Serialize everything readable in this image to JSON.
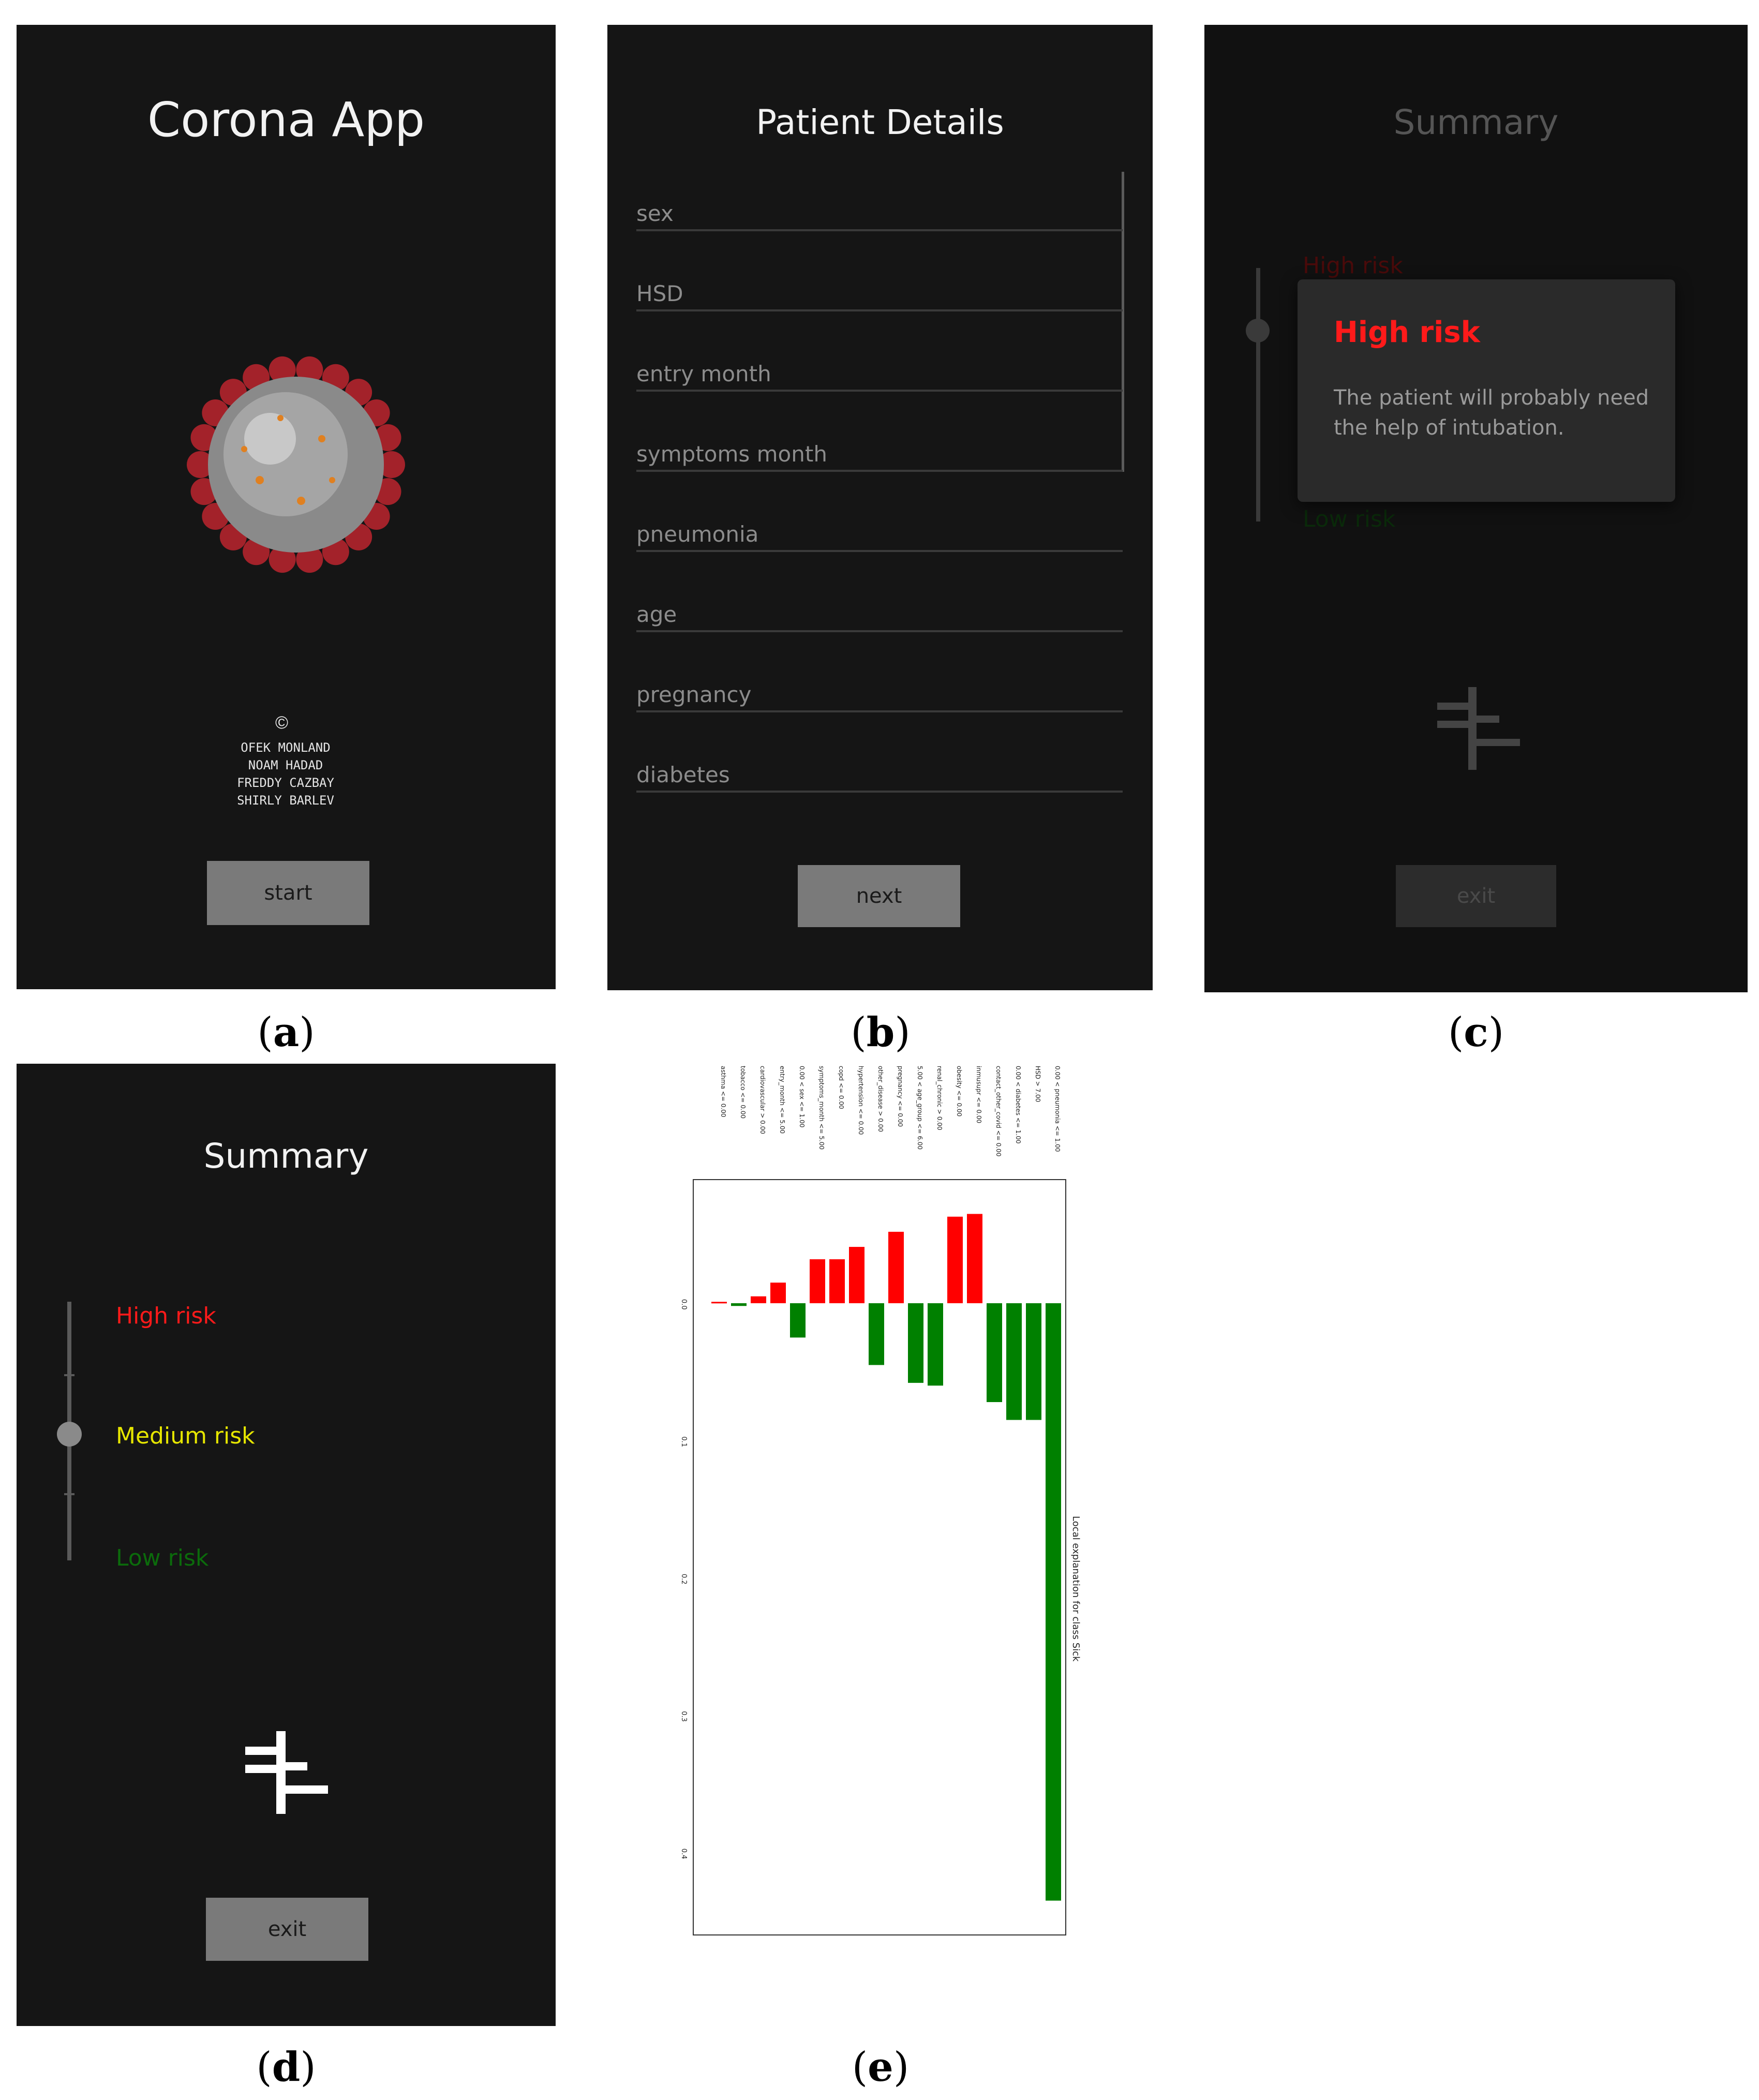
{
  "screens": {
    "a": {
      "title": "Corona App",
      "credits_symbol": "©",
      "credits": [
        "OFEK    MONLAND",
        "NOAM      HADAD",
        "FREDDY  CAZBAY",
        "SHIRLY  BARLEV"
      ],
      "start_label": "start",
      "caption": "a"
    },
    "b": {
      "title": "Patient Details",
      "fields": [
        "sex",
        "HSD",
        "entry month",
        "symptoms month",
        "pneumonia",
        "age",
        "pregnancy",
        "diabetes"
      ],
      "next_label": "next",
      "caption": "b"
    },
    "c": {
      "title": "Summary",
      "high_label": "High risk",
      "low_label": "Low risk",
      "dialog_title": "High risk",
      "dialog_text": "The patient will probably need the help of intubation.",
      "exit_label": "exit",
      "caption": "c"
    },
    "d": {
      "title": "Summary",
      "high_label": "High risk",
      "medium_label": "Medium risk",
      "low_label": "Low risk",
      "exit_label": "exit",
      "caption": "d"
    },
    "e": {
      "caption": "e"
    }
  },
  "colors": {
    "high": "#ff1a1a",
    "medium": "#e6e600",
    "low": "#0b8a0b",
    "bg": "#151515"
  },
  "chart_data": {
    "type": "bar",
    "ylabel": "Local explanation for class Sick",
    "categories": [
      "asthma <= 0.00",
      "tobacco <= 0.00",
      "cardiovascular > 0.00",
      "entry_month <= 5.00",
      "0.00 < sex <= 1.00",
      "symptoms_month <= 5.00",
      "copd <= 0.00",
      "hypertension <= 0.00",
      "other_disease > 0.00",
      "pregnancy <= 0.00",
      "5.00 < age_group <= 6.00",
      "renal_chronic > 0.00",
      "obesity <= 0.00",
      "inmusupr <= 0.00",
      "contact_other_covid <= 0.00",
      "0.00 < diabetes <= 1.00",
      "HSD > 7.00",
      "0.00 < pneumonia <= 1.00"
    ],
    "values": [
      0.001,
      -0.002,
      0.005,
      0.015,
      -0.025,
      0.032,
      0.032,
      0.041,
      -0.045,
      0.052,
      -0.058,
      -0.06,
      0.063,
      0.065,
      -0.072,
      -0.085,
      -0.085,
      -0.435
    ],
    "tick_labels": [
      "0.0",
      "0.1",
      "0.2",
      "0.3",
      "0.4"
    ],
    "ylim": [
      -0.46,
      0.09
    ],
    "positive_color": "#ff0000",
    "negative_color": "#008000"
  }
}
